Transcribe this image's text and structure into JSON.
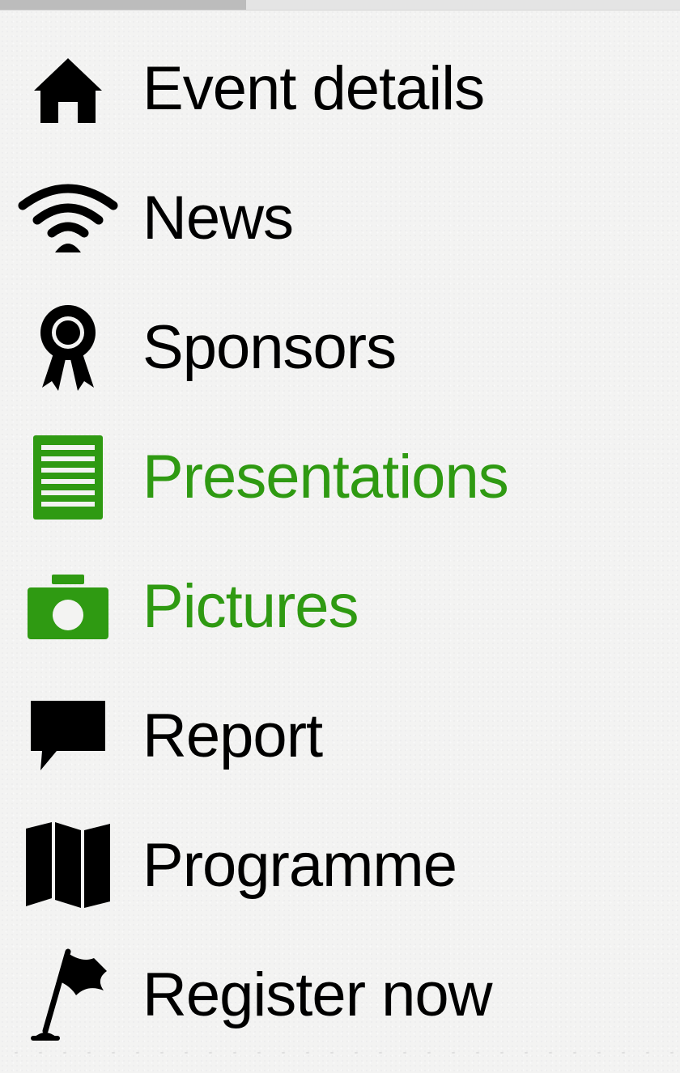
{
  "nav": {
    "accent_color": "#2f9a12",
    "items": [
      {
        "label": "Event details",
        "icon": "home-icon",
        "active": false
      },
      {
        "label": "News",
        "icon": "wifi-icon",
        "active": false
      },
      {
        "label": "Sponsors",
        "icon": "ribbon-award-icon",
        "active": false
      },
      {
        "label": "Presentations",
        "icon": "document-icon",
        "active": true
      },
      {
        "label": "Pictures",
        "icon": "camera-icon",
        "active": true
      },
      {
        "label": "Report",
        "icon": "speech-bubble-icon",
        "active": false
      },
      {
        "label": "Programme",
        "icon": "map-icon",
        "active": false
      },
      {
        "label": "Register now",
        "icon": "flag-icon",
        "active": false
      }
    ]
  }
}
